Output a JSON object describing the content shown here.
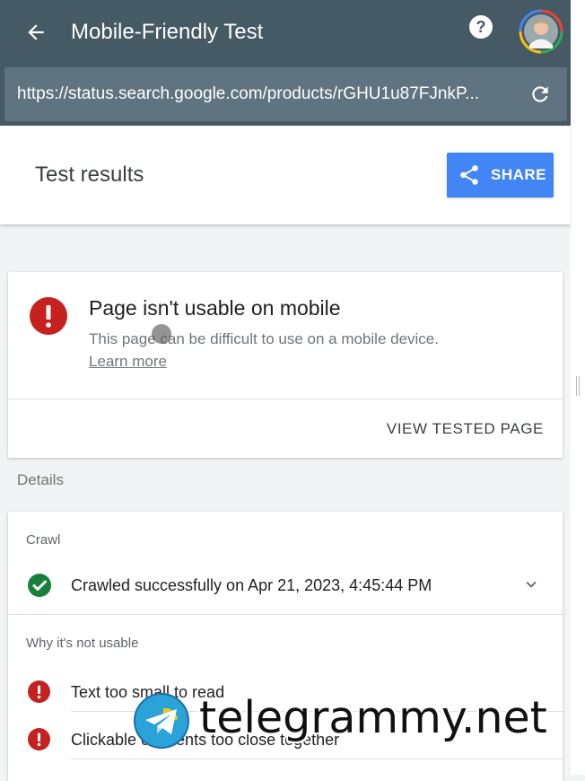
{
  "app_bar": {
    "title": "Mobile-Friendly Test",
    "back_icon": "arrow-back-icon",
    "help_icon": "help-circle-icon",
    "avatar": "user-avatar"
  },
  "url_bar": {
    "url": "https://status.search.google.com/products/rGHU1u87FJnkP...",
    "reload_icon": "reload-icon"
  },
  "results_header": {
    "title": "Test results",
    "share_label": "SHARE",
    "share_icon": "share-icon"
  },
  "verdict": {
    "heading": "Page isn't usable on mobile",
    "description": "This page can be difficult to use on a mobile device.",
    "learn_more": "Learn more",
    "view_tested_page": "VIEW TESTED PAGE",
    "status_icon": "error-icon"
  },
  "details": {
    "label": "Details",
    "crawl_section": "Crawl",
    "crawl_status": "Crawled successfully on Apr 21, 2023, 4:45:44 PM",
    "why_section": "Why it's not usable",
    "issues": [
      {
        "label": "Text too small to read"
      },
      {
        "label": "Clickable elements too close together"
      }
    ]
  },
  "watermark": {
    "text": "telegrammy.net"
  },
  "colors": {
    "app_bar": "#455a64",
    "url_bar": "#5f7480",
    "share_button": "#4285f4",
    "error": "#c5221f",
    "success": "#188038",
    "background": "#f1f3f4"
  }
}
